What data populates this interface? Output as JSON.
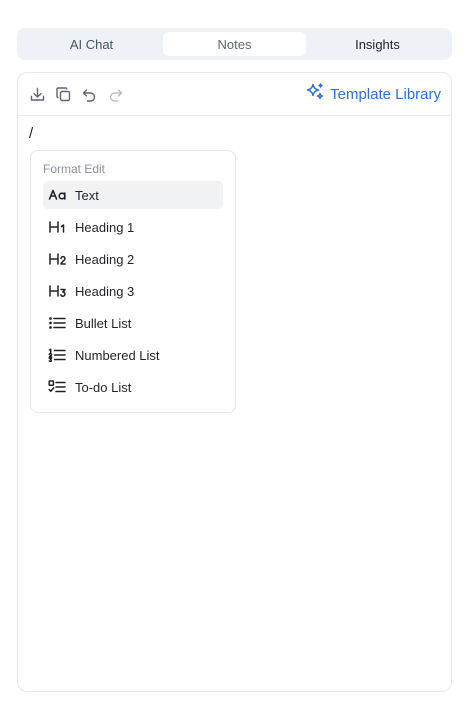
{
  "tabs": [
    {
      "label": "AI Chat"
    },
    {
      "label": "Notes"
    },
    {
      "label": "Insights"
    }
  ],
  "toolbar": {
    "icons": [
      "download-icon",
      "copy-icon",
      "undo-icon",
      "redo-icon"
    ],
    "template_library_label": "Template Library",
    "accent_color": "#2e6fd8"
  },
  "editor": {
    "content": "/"
  },
  "format_menu": {
    "title": "Format Edit",
    "items": [
      {
        "label": "Text",
        "icon": "text-icon"
      },
      {
        "label": "Heading 1",
        "icon": "heading-1-icon"
      },
      {
        "label": "Heading 2",
        "icon": "heading-2-icon"
      },
      {
        "label": "Heading 3",
        "icon": "heading-3-icon"
      },
      {
        "label": "Bullet List",
        "icon": "bullet-list-icon"
      },
      {
        "label": "Numbered List",
        "icon": "numbered-list-icon"
      },
      {
        "label": "To-do List",
        "icon": "todo-list-icon"
      }
    ]
  }
}
